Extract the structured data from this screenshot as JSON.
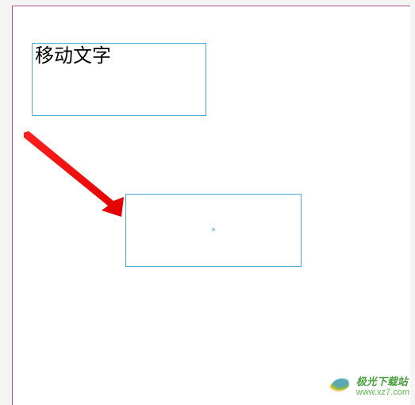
{
  "source_frame": {
    "text": "移动文字"
  },
  "target_frame": {
    "center_marker": "×"
  },
  "watermark": {
    "title": "极光下载站",
    "url": "www.xz7.com"
  },
  "colors": {
    "frame_border": "#4fa8d8",
    "page_border": "#a94b8c",
    "arrow": "#ff0000",
    "watermark_primary": "#4a9e3f",
    "watermark_secondary": "#5fb84f"
  }
}
